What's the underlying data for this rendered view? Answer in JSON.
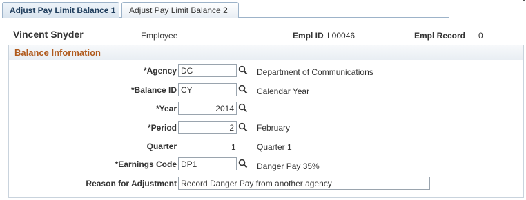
{
  "tabs": [
    {
      "label": "Adjust Pay Limit Balance 1",
      "active": true
    },
    {
      "label": "Adjust Pay Limit Balance 2",
      "active": false
    }
  ],
  "header": {
    "name": "Vincent Snyder",
    "role": "Employee",
    "empl_id_label": "Empl ID",
    "empl_id": "L00046",
    "empl_record_label": "Empl Record",
    "empl_record": "0"
  },
  "section": {
    "title": "Balance Information"
  },
  "form": {
    "agency": {
      "label": "*Agency",
      "value": "DC",
      "desc": "Department of Communications"
    },
    "balance_id": {
      "label": "*Balance ID",
      "value": "CY",
      "desc": "Calendar Year"
    },
    "year": {
      "label": "*Year",
      "value": "2014"
    },
    "period": {
      "label": "*Period",
      "value": "2",
      "desc": "February"
    },
    "quarter": {
      "label": "Quarter",
      "value": "1",
      "desc": "Quarter 1"
    },
    "earnings_code": {
      "label": "*Earnings Code",
      "value": "DP1",
      "desc": "Danger Pay 35%"
    },
    "reason": {
      "label": "Reason for Adjustment",
      "value": "Record Danger Pay from another agency"
    }
  },
  "colors": {
    "section_title": "#b05a1c",
    "border": "#c9d3dd",
    "tab_border": "#9db3c9"
  },
  "icons": {
    "lookup": "search-icon"
  }
}
